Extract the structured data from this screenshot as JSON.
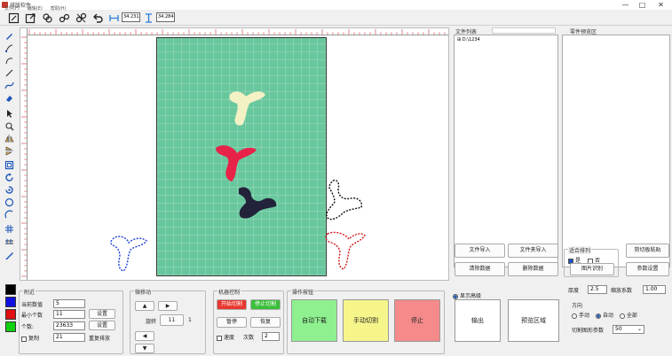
{
  "window": {
    "title": "排版软件",
    "minimize": "—",
    "maximize": "□",
    "close": "✕"
  },
  "menu": [
    "文件(F)",
    "编辑(E)",
    "帮助(H)"
  ],
  "toolbar": {
    "width_value": "34.231",
    "height_value": "34.284"
  },
  "right_panel": {
    "file_list_label": "文件列表",
    "tree_root": "D:\\1234",
    "preview_label": "零件预览区",
    "btn_add_file": "文件导入",
    "btn_add_files": "文件夹导入",
    "btn_clear": "清除数据",
    "btn_delete": "删除数据",
    "btn_auto_nest": "图片识别",
    "btn_manual_nest": "参数设置",
    "btn_paste": "剪切板粘贴",
    "nest_group_label": "适合排列",
    "opt_yes": "是",
    "opt_no": "否"
  },
  "bottom": {
    "params_label": "附近",
    "current_scale_label": "当前数值",
    "current_scale_value": "5",
    "gap_label": "最小个数",
    "gap_value": "11",
    "btn_set_gap": "设置",
    "count_label": "个数:",
    "count_value": "23633",
    "btn_set_count": "设置",
    "checkbox_group_label": "复制",
    "checkbox_group_value": "21",
    "btn_set_group": "重复排放",
    "move_label": "微移动",
    "btn_up": "▲",
    "btn_left": "◀",
    "btn_right": "▶",
    "btn_down": "▼",
    "move_step": "11",
    "rotate_label": "旋转",
    "rotate_value": "1",
    "machine_label": "机器控制",
    "btn_start": "开始切割",
    "btn_stop": "停止切割",
    "btn_pause": "暂停",
    "btn_resume": "恢复",
    "speed_check": "速度",
    "speed_label": "次数",
    "speed_value": "2",
    "ops_label": "操作按钮",
    "btn_auto_cut": "自动下载",
    "btn_manual_cut": "手动切割",
    "btn_stop_red": "停止",
    "advanced_check": "显示高级",
    "btn_output": "输出",
    "btn_settings": "预览区域",
    "thickness_label": "厚度",
    "thickness_value": "2.5",
    "scale_label": "缩放系数",
    "scale_value": "1.00",
    "mode_label": "方向",
    "mode_manual": "手动",
    "mode_auto": "自动",
    "mode_all": "全部",
    "paper_label": "切割图形参数",
    "paper_value": "50"
  },
  "colors": {
    "scan_bg": "#69c79d",
    "piece_yellow": "#f3f2c4",
    "piece_red": "#e8234a",
    "piece_dark": "#22223a",
    "btn_green": "#8ff08f",
    "btn_yellow": "#f6f58a",
    "btn_red": "#f48a8a",
    "swatch_black": "#000000",
    "swatch_blue": "#1010e0",
    "swatch_red": "#e01010",
    "swatch_green": "#10d010"
  }
}
